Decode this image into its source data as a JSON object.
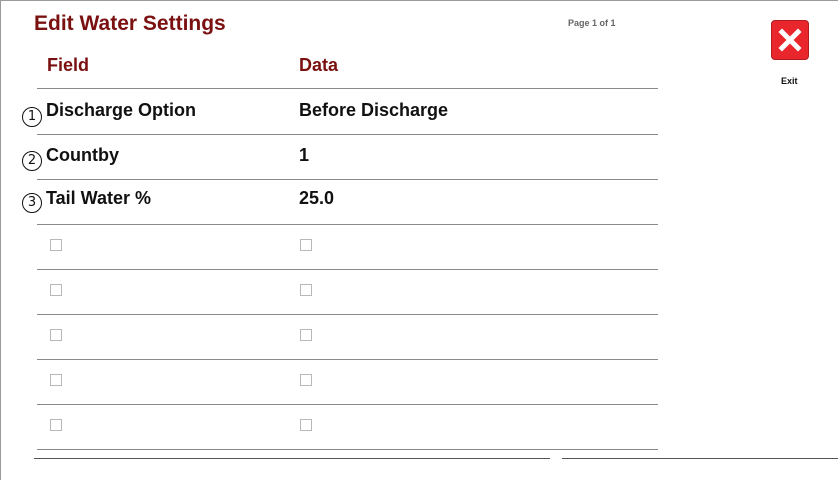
{
  "header": {
    "title": "Edit Water Settings",
    "page_indicator": "Page 1 of 1"
  },
  "columns": {
    "field": "Field",
    "data": "Data"
  },
  "rows": [
    {
      "number": "1",
      "field": "Discharge Option",
      "data": "Before Discharge"
    },
    {
      "number": "2",
      "field": "Countby",
      "data": "1"
    },
    {
      "number": "3",
      "field": "Tail Water %",
      "data": "25.0"
    }
  ],
  "empty_rows": 5,
  "exit": {
    "label": "Exit",
    "icon": "close-icon",
    "color": "#e8262c"
  },
  "colors": {
    "title": "#7a1010",
    "text": "#111111"
  }
}
